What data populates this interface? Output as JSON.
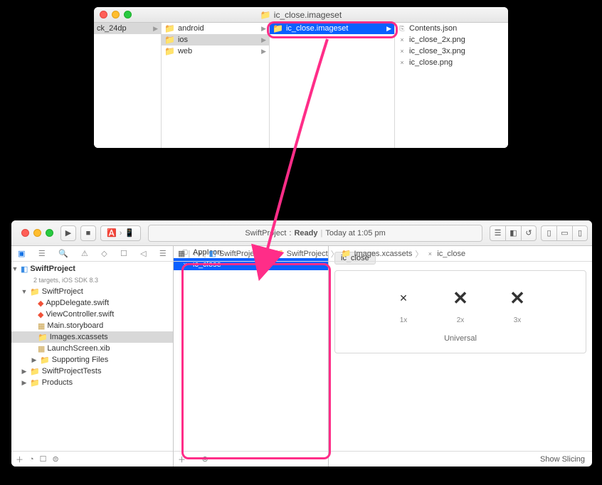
{
  "finder": {
    "title": "ic_close.imageset",
    "col0": {
      "item": "ck_24dp"
    },
    "col1": {
      "items": [
        "android",
        "ios",
        "web"
      ],
      "selected_index": 1
    },
    "col2": {
      "items": [
        "ic_close.imageset"
      ],
      "selected_index": 0
    },
    "col3": {
      "items": [
        "Contents.json",
        "ic_close_2x.png",
        "ic_close_3x.png",
        "ic_close.png"
      ]
    }
  },
  "xcode": {
    "status": {
      "project": "SwiftProject",
      "state": "Ready",
      "time": "Today at 1:05 pm"
    },
    "jumpbar": [
      "SwiftProject",
      "SwiftProject",
      "Images.xcassets",
      "ic_close"
    ],
    "tree": {
      "project": "SwiftProject",
      "project_sub": "2 targets, iOS SDK 8.3",
      "group_app": "SwiftProject",
      "files": {
        "appdelegate": "AppDelegate.swift",
        "viewcontroller": "ViewController.swift",
        "storyboard": "Main.storyboard",
        "assets": "Images.xcassets",
        "launchscreen": "LaunchScreen.xib",
        "supporting": "Supporting Files"
      },
      "group_tests": "SwiftProjectTests",
      "group_products": "Products"
    },
    "assets": {
      "items": [
        "AppIcon",
        "ic_close"
      ],
      "selected_index": 1,
      "editor_title": "ic_close",
      "slots": {
        "s1": "1x",
        "s2": "2x",
        "s3": "3x",
        "universal": "Universal"
      }
    },
    "footer": {
      "show_slicing": "Show Slicing"
    }
  }
}
